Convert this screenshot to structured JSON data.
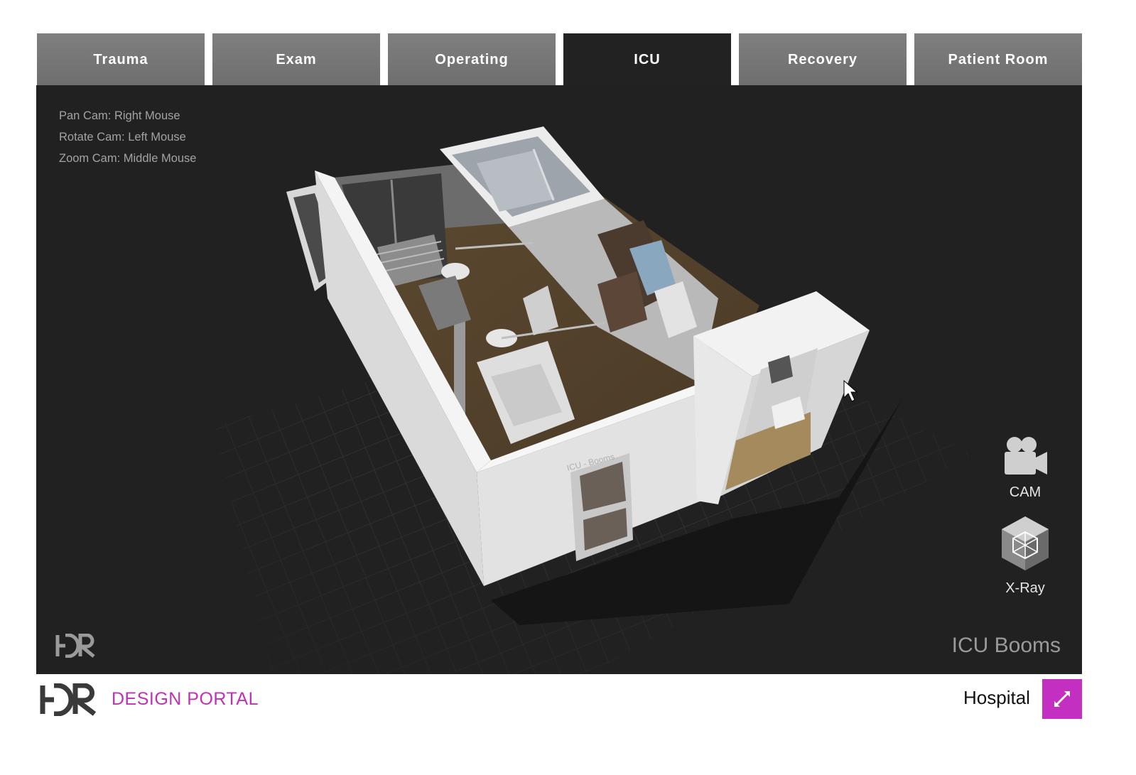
{
  "tabs": [
    {
      "label": "Trauma",
      "active": false
    },
    {
      "label": "Exam",
      "active": false
    },
    {
      "label": "Operating",
      "active": false
    },
    {
      "label": "ICU",
      "active": true
    },
    {
      "label": "Recovery",
      "active": false
    },
    {
      "label": "Patient Room",
      "active": false
    }
  ],
  "viewport": {
    "help": [
      "Pan Cam: Right Mouse",
      "Rotate Cam: Left Mouse",
      "Zoom Cam: Middle Mouse"
    ],
    "tools": {
      "cam_label": "CAM",
      "xray_label": "X-Ray"
    },
    "room_label": "ICU Booms",
    "wall_sign": "ICU - Booms"
  },
  "footer": {
    "portal_label": "DESIGN PORTAL",
    "category_label": "Hospital"
  },
  "colors": {
    "tab_inactive": "#7a7a7a",
    "tab_active": "#222222",
    "viewport_bg": "#212121",
    "accent_magenta": "#c32fc0"
  },
  "icons": [
    "movie-camera-icon",
    "xray-cube-icon",
    "expand-arrows-icon",
    "hdr-logo",
    "mouse-cursor-icon"
  ]
}
